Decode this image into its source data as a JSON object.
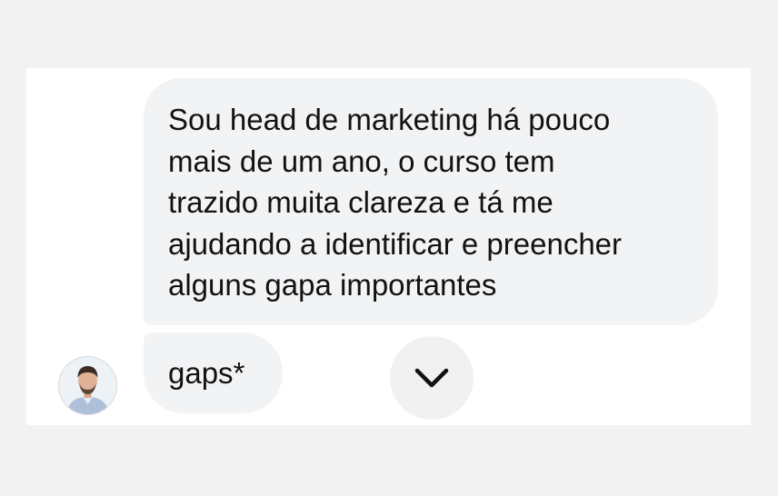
{
  "thread": {
    "messages": [
      {
        "lines": [
          "Sou head de marketing há pouco",
          "mais de um ano, o curso tem",
          "trazido muita clareza e tá me",
          "ajudando a identificar e preencher",
          "alguns gapa importantes"
        ]
      },
      {
        "text": "gaps*"
      }
    ]
  },
  "icons": {
    "avatar": "profile-photo",
    "scroll_down": "chevron-down-icon"
  },
  "colors": {
    "background": "#f2f2f3",
    "bubble": "#f2f3f5",
    "text": "#121212"
  }
}
